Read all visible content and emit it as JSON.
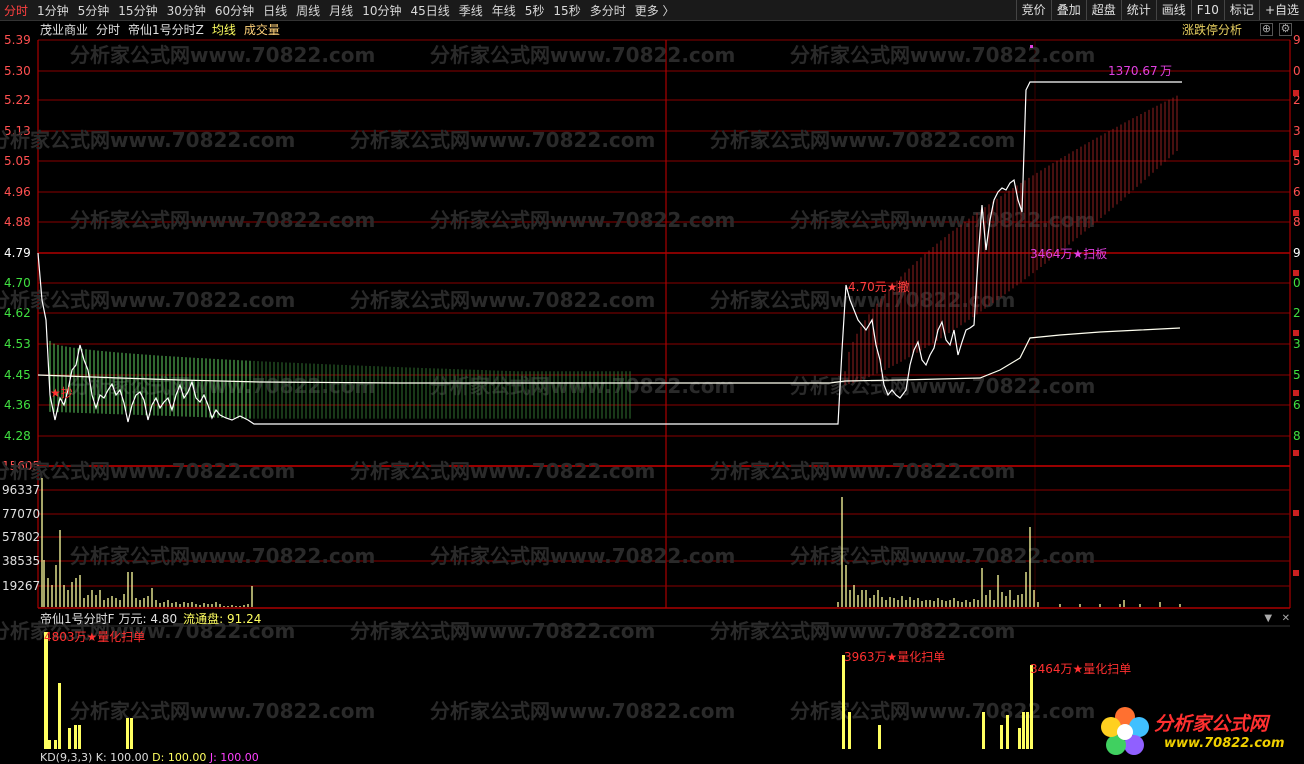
{
  "toolbar": {
    "tabs": [
      "分时",
      "1分钟",
      "5分钟",
      "15分钟",
      "30分钟",
      "60分钟",
      "日线",
      "周线",
      "月线",
      "10分钟",
      "45日线",
      "季线",
      "年线",
      "5秒",
      "15秒",
      "多分时",
      "更多 〉"
    ],
    "right_buttons": [
      "竞价",
      "叠加",
      "超盘",
      "统计",
      "画线",
      "F10",
      "标记",
      "+自选"
    ]
  },
  "header": {
    "stock_name": "茂业商业",
    "period": "分时",
    "indicator": "帝仙1号分时Z",
    "avg_line": "均线",
    "volume": "成交量",
    "right_label": "涨跌停分析"
  },
  "price_axis": [
    "5.39",
    "5.30",
    "5.22",
    "5.13",
    "5.05",
    "4.96",
    "4.88",
    "4.79",
    "4.70",
    "4.62",
    "4.53",
    "4.45",
    "4.36",
    "4.28"
  ],
  "volume_axis": [
    "15605",
    "96337",
    "77070",
    "57802",
    "38535",
    "19267"
  ],
  "annotations": {
    "top_amount": "1370.67",
    "top_unit": "万",
    "limit_up": "3464万★扫板",
    "pullback": "4.70元★撤",
    "early": "★抄"
  },
  "sub_header": {
    "name": "帝仙1号分时F",
    "wan": "万元: 4.80",
    "flow_label": "流通盘: 91.24"
  },
  "sub_annotations": [
    "4803万★量化扫单",
    "3963万★量化扫单",
    "3464万★量化扫单"
  ],
  "kd": {
    "label": "KD(9,3,3)",
    "k": "K: 100.00",
    "d": "D: 100.00",
    "j": "J: 100.00"
  },
  "watermark": {
    "text": "分析家公式网www.70822.com",
    "brand": "分析家公式网",
    "url": "www.70822.com"
  },
  "colors": {
    "price_line": "#ffffff",
    "avg_line": "#fffff0",
    "grid": "#8a0000",
    "up": "#ff4444",
    "down": "#44ff44",
    "volume": "#ffffa0",
    "signal": "#ffff60",
    "magenta": "#e040e0"
  }
}
